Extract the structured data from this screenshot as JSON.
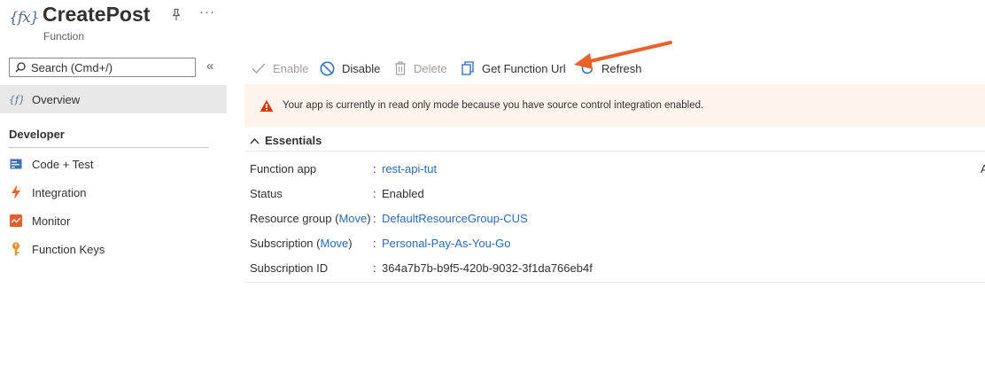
{
  "header": {
    "logo_text": "{fx}",
    "title": "CreatePost",
    "subtitle": "Function",
    "more_label": "···"
  },
  "sidebar": {
    "search_placeholder": "Search (Cmd+/)",
    "collapse_label": "«",
    "items": [
      {
        "label": "Overview",
        "icon": "function-icon",
        "active": true
      },
      {
        "label": "Code + Test",
        "icon": "code-icon"
      },
      {
        "label": "Integration",
        "icon": "lightning-icon"
      },
      {
        "label": "Monitor",
        "icon": "monitor-icon"
      },
      {
        "label": "Function Keys",
        "icon": "key-icon"
      }
    ],
    "section_developer": "Developer"
  },
  "toolbar": {
    "enable": "Enable",
    "disable": "Disable",
    "delete": "Delete",
    "get_url": "Get Function Url",
    "refresh": "Refresh"
  },
  "banner": {
    "message": "Your app is currently in read only mode because you have source control integration enabled.",
    "icon": "warning-icon"
  },
  "essentials": {
    "title": "Essentials",
    "move_label": "Move",
    "rows": {
      "function_app": {
        "label": "Function app",
        "value": "rest-api-tut"
      },
      "status": {
        "label": "Status",
        "value": "Enabled"
      },
      "resource_group": {
        "label_pre": "Resource group (",
        "label_post": ")",
        "value": "DefaultResourceGroup-CUS"
      },
      "subscription": {
        "label_pre": "Subscription (",
        "label_post": ")",
        "value": "Personal-Pay-As-You-Go"
      },
      "subscription_id": {
        "label": "Subscription ID",
        "value": "364a7b7b-b9f5-420b-9032-3f1da766eb4f"
      }
    },
    "colon": ":",
    "overflow_text": "A"
  },
  "colors": {
    "accent": "#0078d4",
    "link": "#2b6bb7",
    "warning": "#d83b01",
    "banner_bg": "#fff4ec",
    "annotation_arrow": "#e8622a"
  }
}
